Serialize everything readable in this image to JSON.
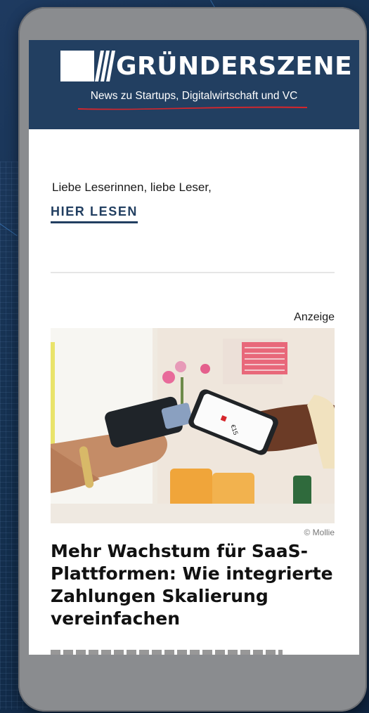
{
  "header": {
    "logo_text": "GRÜNDERSZENE",
    "tagline": "News zu Startups, Digitalwirtschaft und VC"
  },
  "intro": {
    "greeting": "Liebe Leserinnen, liebe Leser,",
    "read_link": "HIER LESEN"
  },
  "ad": {
    "label": "Anzeige",
    "image_credit": "© Mollie",
    "phone_amount": "€15"
  },
  "article": {
    "headline": "Mehr Wachstum für SaaS-Plattformen: Wie integrierte Zahlungen Skalierung vereinfachen"
  },
  "colors": {
    "brand_navy": "#223f61",
    "accent_red": "#d6262c",
    "background_blue": "#1b3658",
    "device_gray": "#8a8c8f"
  }
}
